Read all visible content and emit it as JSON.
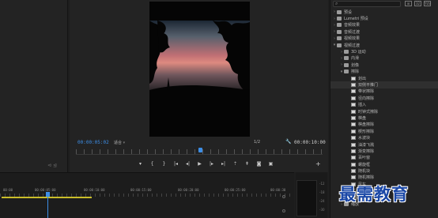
{
  "program_monitor": {
    "timecode": "00:00:05:02",
    "fit": "适合",
    "resolution": "1/2",
    "end_timecode": "00:00:10:00",
    "transport": [
      "mark-in",
      "mark-out",
      "go-to-in",
      "step-back",
      "play",
      "step-forward",
      "go-to-out",
      "lift",
      "extract",
      "export-frame",
      "multi-camera"
    ]
  },
  "left_panel": {
    "icons": "⊲ ⊴"
  },
  "effects_panel": {
    "search_placeholder": "",
    "tree": [
      {
        "level": 1,
        "twirl": ">",
        "kind": "folder",
        "label": "预设"
      },
      {
        "level": 1,
        "twirl": ">",
        "kind": "folder",
        "label": "Lumetri 预设"
      },
      {
        "level": 1,
        "twirl": ">",
        "kind": "folder",
        "label": "音频效果"
      },
      {
        "level": 1,
        "twirl": ">",
        "kind": "folder",
        "label": "音频过渡"
      },
      {
        "level": 1,
        "twirl": ">",
        "kind": "folder",
        "label": "视频效果"
      },
      {
        "level": 1,
        "twirl": "v",
        "kind": "folder",
        "label": "视频过渡"
      },
      {
        "level": 2,
        "twirl": ">",
        "kind": "folder",
        "label": "3D 运动"
      },
      {
        "level": 2,
        "twirl": ">",
        "kind": "folder",
        "label": "内滑"
      },
      {
        "level": 2,
        "twirl": ">",
        "kind": "folder",
        "label": "划像"
      },
      {
        "level": 2,
        "twirl": "v",
        "kind": "folder",
        "label": "擦除"
      },
      {
        "level": 3,
        "twirl": "",
        "kind": "fx",
        "label": "划出"
      },
      {
        "level": 3,
        "twirl": "",
        "kind": "fx",
        "label": "双侧平推门",
        "selected": true
      },
      {
        "level": 3,
        "twirl": "",
        "kind": "fx",
        "label": "带状擦除"
      },
      {
        "level": 3,
        "twirl": "",
        "kind": "fx",
        "label": "径向擦除"
      },
      {
        "level": 3,
        "twirl": "",
        "kind": "fx",
        "label": "插入"
      },
      {
        "level": 3,
        "twirl": "",
        "kind": "fx",
        "label": "时钟式擦除"
      },
      {
        "level": 3,
        "twirl": "",
        "kind": "fx",
        "label": "棋盘"
      },
      {
        "level": 3,
        "twirl": "",
        "kind": "fx",
        "label": "棋盘擦除"
      },
      {
        "level": 3,
        "twirl": "",
        "kind": "fx",
        "label": "楔形擦除"
      },
      {
        "level": 3,
        "twirl": "",
        "kind": "fx",
        "label": "水波块"
      },
      {
        "level": 3,
        "twirl": "",
        "kind": "fx",
        "label": "油漆飞溅"
      },
      {
        "level": 3,
        "twirl": "",
        "kind": "fx",
        "label": "渐变擦除"
      },
      {
        "level": 3,
        "twirl": "",
        "kind": "fx",
        "label": "百叶窗"
      },
      {
        "level": 3,
        "twirl": "",
        "kind": "fx",
        "label": "螺旋框"
      },
      {
        "level": 3,
        "twirl": "",
        "kind": "fx",
        "label": "随机块"
      },
      {
        "level": 3,
        "twirl": "",
        "kind": "fx",
        "label": "随机擦除"
      },
      {
        "level": 3,
        "twirl": "",
        "kind": "fx",
        "label": "风车"
      },
      {
        "level": 2,
        "twirl": ">",
        "kind": "folder",
        "label": "沉浸式视频"
      },
      {
        "level": 2,
        "twirl": ">",
        "kind": "folder",
        "label": "溶解"
      },
      {
        "level": 2,
        "twirl": ">",
        "kind": "folder",
        "label": "缩放"
      }
    ]
  },
  "timeline": {
    "ticks": [
      "00:00",
      "00:00:05:00",
      "00:00:10:00",
      "00:00:15:00",
      "00:00:20:00",
      "00:00:25:00",
      "00:00:30"
    ]
  },
  "meter": {
    "labels": [
      "-12",
      "-18",
      "-24",
      "-30"
    ]
  },
  "watermark": "最需教育",
  "colors": {
    "accent_blue": "#3d8ee6",
    "work_area": "#c9bd2a",
    "watermark": "#1a47a6"
  }
}
